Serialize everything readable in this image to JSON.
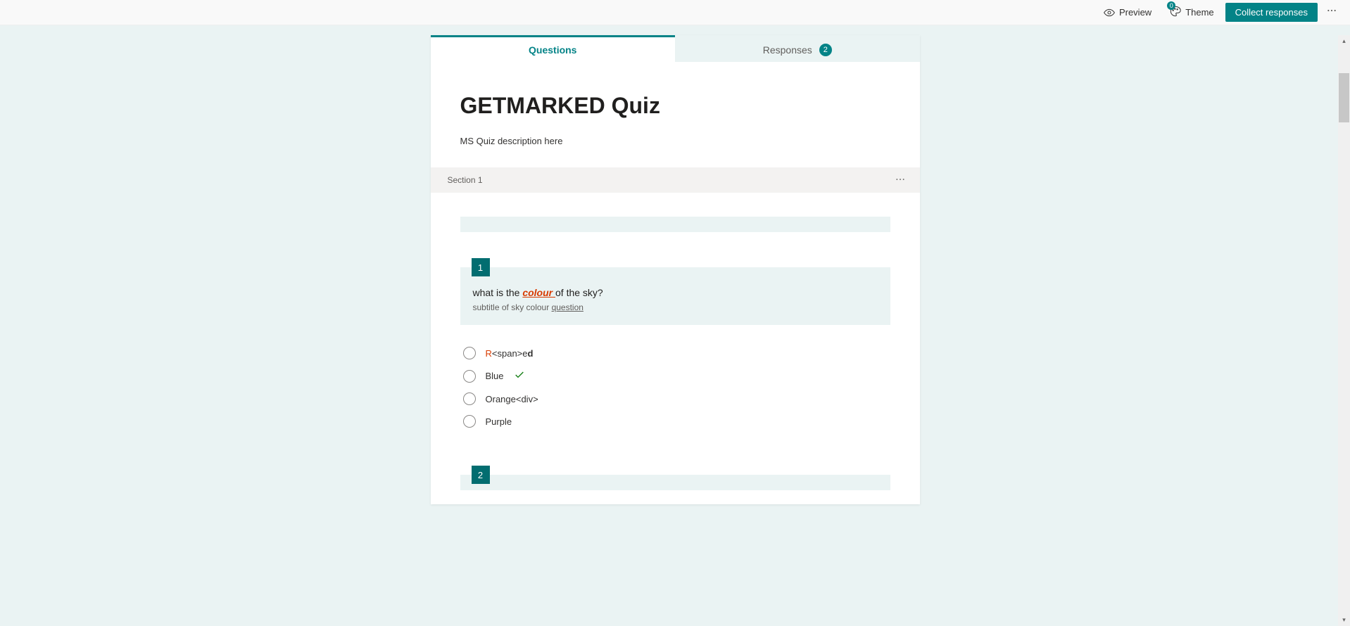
{
  "topbar": {
    "preview_label": "Preview",
    "theme_label": "Theme",
    "theme_badge": "0",
    "collect_label": "Collect responses"
  },
  "tabs": {
    "questions_label": "Questions",
    "responses_label": "Responses",
    "responses_count": "2"
  },
  "quiz": {
    "title": "GETMARKED Quiz",
    "description": "MS Quiz description here"
  },
  "section": {
    "label": "Section 1"
  },
  "question1": {
    "number": "1",
    "text_prefix": "what is the ",
    "text_colour": "colour ",
    "text_suffix": "of the sky?",
    "subtitle_prefix": "subtitle of sky colour ",
    "subtitle_underlined": "question",
    "options": [
      {
        "html_parts": {
          "red": "R",
          "mid": "<span>e",
          "bold": "d"
        },
        "correct": false
      },
      {
        "label": "Blue",
        "correct": true
      },
      {
        "label": "Orange<div>",
        "correct": false
      },
      {
        "label": "Purple",
        "correct": false
      }
    ]
  },
  "question2": {
    "number": "2"
  }
}
